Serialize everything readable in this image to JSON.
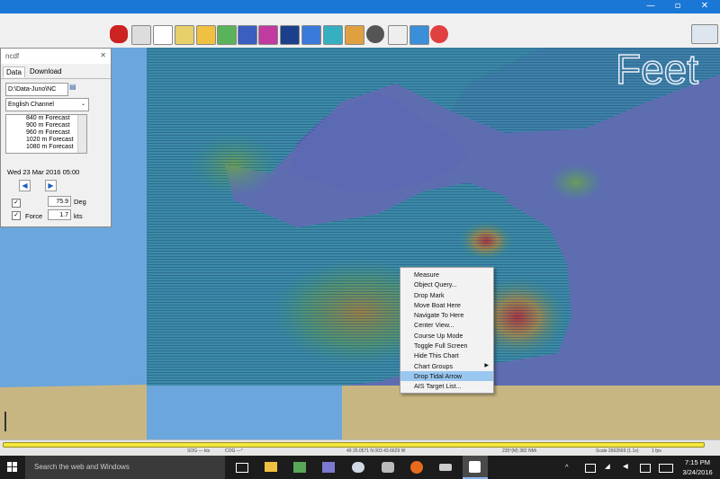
{
  "titlebar": {
    "minimize_glyph": "—",
    "maximize_glyph": "▫",
    "close_glyph": "✕"
  },
  "toolbar": {
    "icons": [
      "boat-icon",
      "settings-wrench-icon",
      "text-tool-icon",
      "route-icon",
      "zoom-tool-icon",
      "vertical-arrows-icon",
      "checklist-icon",
      "track-icon",
      "tide-icon",
      "help-icon",
      "layers-icon",
      "waypoint-icon",
      "compass-wheel-icon",
      "arrow-tool-icon",
      "scale-icon",
      "lifebuoy-icon"
    ],
    "compass_icon": "north-compass-icon"
  },
  "map": {
    "watermark": "Feet"
  },
  "ncdf_panel": {
    "title": "ncdf",
    "tabs": [
      {
        "label": "Data"
      },
      {
        "label": "Download"
      }
    ],
    "path": "D:\\Data-Juno\\NC",
    "region": "English Channel",
    "list": [
      "840 m Forecast",
      "900 m Forecast",
      "960 m Forecast",
      "1020 m Forecast",
      "1080 m Forecast"
    ],
    "datetime": "Wed 23 Mar 2016 05:00",
    "direction_value": "75.9",
    "direction_unit": "Deg",
    "force_label": "Force",
    "force_value": "1.7",
    "force_unit": "kts"
  },
  "context_menu": {
    "items": [
      "Measure",
      "Object Query...",
      "Drop Mark",
      "Move Boat Here",
      "Navigate To Here",
      "Center View...",
      "Course Up Mode",
      "Toggle Full Screen",
      "Hide This Chart",
      "Chart Groups",
      "Drop Tidal Arrow",
      "AIS Target List..."
    ],
    "highlighted": "Drop Tidal Arrow",
    "submenu_item": "Chart Groups"
  },
  "statusbar": {
    "sog": "SOG --- kts",
    "cog": "COG ---°",
    "position": "49 25.0571 N   003 43.6629 W",
    "bearing": "235°(M)  382 NMi",
    "scale": "Scale 2662669 (1.1x)",
    "fps": "1 fps"
  },
  "taskbar": {
    "search_placeholder": "Search the web and Windows",
    "time": "7:15 PM",
    "date": "3/24/2016"
  },
  "colors": {
    "water": "#6ba6dc",
    "land": "#c8b682",
    "menu_highlight": "#99c7f0",
    "titlebar": "#1a77d6",
    "progress": "#f4e73d"
  }
}
